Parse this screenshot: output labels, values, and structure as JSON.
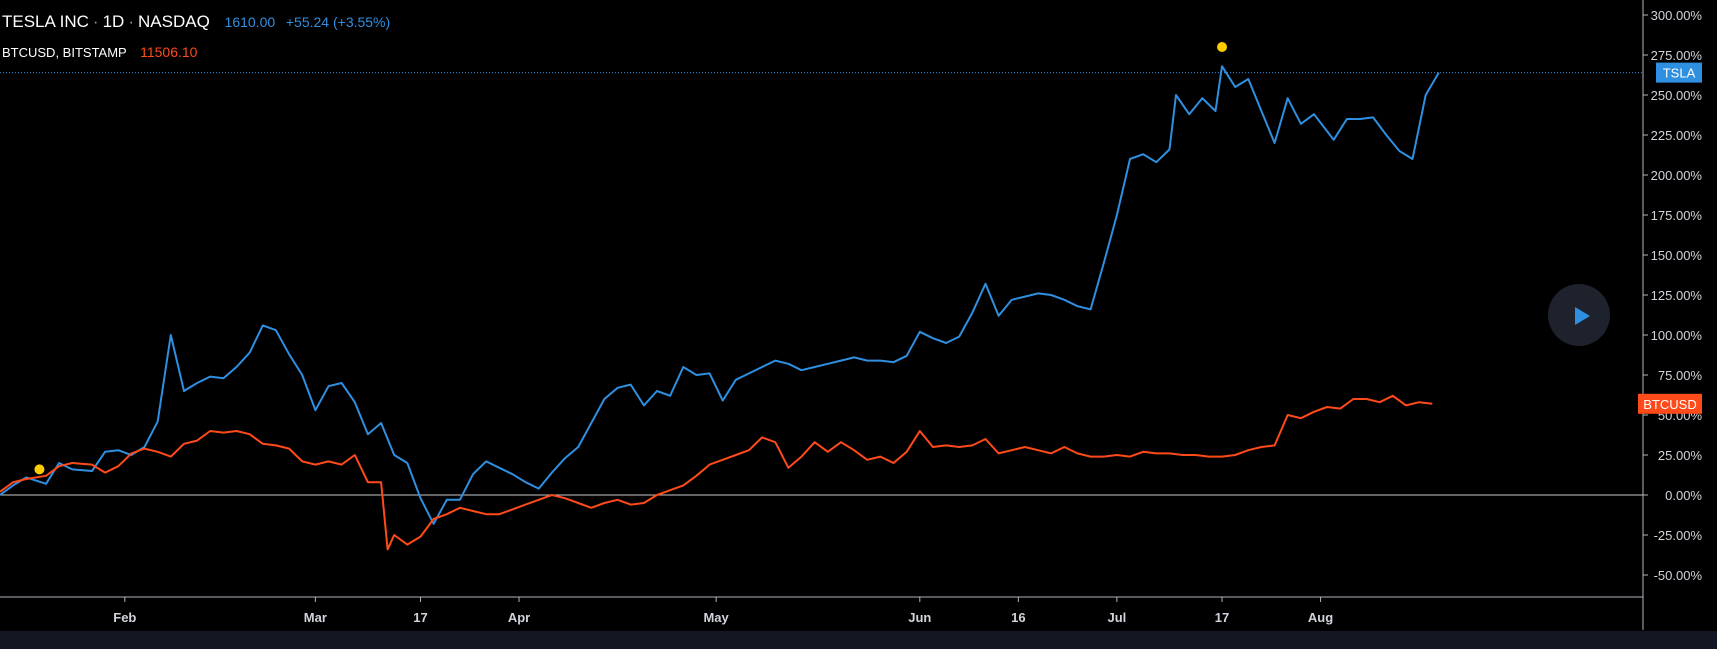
{
  "legend": {
    "main_symbol": "TESLA INC",
    "main_interval": "1D",
    "main_exchange": "NASDAQ",
    "main_price": "1610.00",
    "main_change": "+55.24 (+3.55%)",
    "compare_symbol": "BTCUSD, BITSTAMP",
    "compare_price": "11506.10"
  },
  "colors": {
    "tsla": "#2f8fe0",
    "btc": "#ff4a1a",
    "marker": "#ffcc00",
    "background": "#000000",
    "axis_text": "#d1d4dc"
  },
  "play_button": {
    "icon": "play-icon"
  },
  "chart_data": {
    "type": "line",
    "y_unit": "percent change",
    "ylim": [
      -65,
      305
    ],
    "y_ticks": [
      "300.00%",
      "275.00%",
      "250.00%",
      "225.00%",
      "200.00%",
      "175.00%",
      "150.00%",
      "125.00%",
      "100.00%",
      "75.00%",
      "50.00%",
      "25.00%",
      "0.00%",
      "-25.00%",
      "-50.00%"
    ],
    "y_tick_values": [
      300,
      275,
      250,
      225,
      200,
      175,
      150,
      125,
      100,
      75,
      50,
      25,
      0,
      -25,
      -50
    ],
    "x_start": "2020-01-13",
    "x_end": "2020-08-21",
    "x_ticks": [
      {
        "label": "Feb",
        "date": "2020-02-01"
      },
      {
        "label": "Mar",
        "date": "2020-03-01"
      },
      {
        "label": "17",
        "date": "2020-03-17"
      },
      {
        "label": "Apr",
        "date": "2020-04-01"
      },
      {
        "label": "May",
        "date": "2020-05-01"
      },
      {
        "label": "Jun",
        "date": "2020-06-01"
      },
      {
        "label": "16",
        "date": "2020-06-16"
      },
      {
        "label": "Jul",
        "date": "2020-07-01"
      },
      {
        "label": "17",
        "date": "2020-07-17"
      },
      {
        "label": "Aug",
        "date": "2020-08-01"
      }
    ],
    "series": [
      {
        "name": "TSLA",
        "label": "TSLA",
        "color": "#2f8fe0",
        "points": [
          [
            "2020-01-13",
            0
          ],
          [
            "2020-01-15",
            6
          ],
          [
            "2020-01-17",
            11
          ],
          [
            "2020-01-20",
            7
          ],
          [
            "2020-01-22",
            20
          ],
          [
            "2020-01-24",
            16
          ],
          [
            "2020-01-27",
            15
          ],
          [
            "2020-01-29",
            27
          ],
          [
            "2020-01-31",
            28
          ],
          [
            "2020-02-02",
            25
          ],
          [
            "2020-02-04",
            30
          ],
          [
            "2020-02-06",
            46
          ],
          [
            "2020-02-08",
            100
          ],
          [
            "2020-02-10",
            65
          ],
          [
            "2020-02-12",
            70
          ],
          [
            "2020-02-14",
            74
          ],
          [
            "2020-02-16",
            73
          ],
          [
            "2020-02-18",
            80
          ],
          [
            "2020-02-20",
            89
          ],
          [
            "2020-02-22",
            106
          ],
          [
            "2020-02-24",
            103
          ],
          [
            "2020-02-26",
            88
          ],
          [
            "2020-02-28",
            75
          ],
          [
            "2020-03-01",
            53
          ],
          [
            "2020-03-03",
            68
          ],
          [
            "2020-03-05",
            70
          ],
          [
            "2020-03-07",
            58
          ],
          [
            "2020-03-09",
            38
          ],
          [
            "2020-03-11",
            45
          ],
          [
            "2020-03-13",
            25
          ],
          [
            "2020-03-15",
            20
          ],
          [
            "2020-03-17",
            -2
          ],
          [
            "2020-03-19",
            -18
          ],
          [
            "2020-03-21",
            -3
          ],
          [
            "2020-03-23",
            -3
          ],
          [
            "2020-03-25",
            13
          ],
          [
            "2020-03-27",
            21
          ],
          [
            "2020-03-29",
            17
          ],
          [
            "2020-03-31",
            13
          ],
          [
            "2020-04-02",
            8
          ],
          [
            "2020-04-04",
            4
          ],
          [
            "2020-04-06",
            14
          ],
          [
            "2020-04-08",
            23
          ],
          [
            "2020-04-10",
            30
          ],
          [
            "2020-04-12",
            45
          ],
          [
            "2020-04-14",
            60
          ],
          [
            "2020-04-16",
            67
          ],
          [
            "2020-04-18",
            69
          ],
          [
            "2020-04-20",
            56
          ],
          [
            "2020-04-22",
            65
          ],
          [
            "2020-04-24",
            62
          ],
          [
            "2020-04-26",
            80
          ],
          [
            "2020-04-28",
            75
          ],
          [
            "2020-04-30",
            76
          ],
          [
            "2020-05-02",
            59
          ],
          [
            "2020-05-04",
            72
          ],
          [
            "2020-05-06",
            76
          ],
          [
            "2020-05-08",
            80
          ],
          [
            "2020-05-10",
            84
          ],
          [
            "2020-05-12",
            82
          ],
          [
            "2020-05-14",
            78
          ],
          [
            "2020-05-16",
            80
          ],
          [
            "2020-05-18",
            82
          ],
          [
            "2020-05-20",
            84
          ],
          [
            "2020-05-22",
            86
          ],
          [
            "2020-05-24",
            84
          ],
          [
            "2020-05-26",
            84
          ],
          [
            "2020-05-28",
            83
          ],
          [
            "2020-05-30",
            87
          ],
          [
            "2020-06-01",
            102
          ],
          [
            "2020-06-03",
            98
          ],
          [
            "2020-06-05",
            95
          ],
          [
            "2020-06-07",
            99
          ],
          [
            "2020-06-09",
            114
          ],
          [
            "2020-06-11",
            132
          ],
          [
            "2020-06-13",
            112
          ],
          [
            "2020-06-15",
            122
          ],
          [
            "2020-06-17",
            124
          ],
          [
            "2020-06-19",
            126
          ],
          [
            "2020-06-21",
            125
          ],
          [
            "2020-06-23",
            122
          ],
          [
            "2020-06-25",
            118
          ],
          [
            "2020-06-27",
            116
          ],
          [
            "2020-06-29",
            145
          ],
          [
            "2020-07-01",
            175
          ],
          [
            "2020-07-03",
            210
          ],
          [
            "2020-07-05",
            213
          ],
          [
            "2020-07-07",
            208
          ],
          [
            "2020-07-09",
            216
          ],
          [
            "2020-07-10",
            250
          ],
          [
            "2020-07-12",
            238
          ],
          [
            "2020-07-14",
            248
          ],
          [
            "2020-07-16",
            240
          ],
          [
            "2020-07-17",
            268
          ],
          [
            "2020-07-19",
            255
          ],
          [
            "2020-07-21",
            260
          ],
          [
            "2020-07-23",
            240
          ],
          [
            "2020-07-25",
            220
          ],
          [
            "2020-07-27",
            248
          ],
          [
            "2020-07-29",
            232
          ],
          [
            "2020-07-31",
            238
          ],
          [
            "2020-08-03",
            222
          ],
          [
            "2020-08-05",
            235
          ],
          [
            "2020-08-07",
            235
          ],
          [
            "2020-08-09",
            236
          ],
          [
            "2020-08-11",
            225
          ],
          [
            "2020-08-13",
            215
          ],
          [
            "2020-08-15",
            210
          ],
          [
            "2020-08-17",
            250
          ],
          [
            "2020-08-19",
            264
          ]
        ]
      },
      {
        "name": "BTCUSD",
        "label": "BTCUSD",
        "color": "#ff4a1a",
        "points": [
          [
            "2020-01-13",
            2
          ],
          [
            "2020-01-15",
            8
          ],
          [
            "2020-01-17",
            10
          ],
          [
            "2020-01-20",
            12
          ],
          [
            "2020-01-22",
            18
          ],
          [
            "2020-01-24",
            20
          ],
          [
            "2020-01-27",
            19
          ],
          [
            "2020-01-29",
            14
          ],
          [
            "2020-01-31",
            18
          ],
          [
            "2020-02-02",
            26
          ],
          [
            "2020-02-04",
            29
          ],
          [
            "2020-02-06",
            27
          ],
          [
            "2020-02-08",
            24
          ],
          [
            "2020-02-10",
            32
          ],
          [
            "2020-02-12",
            34
          ],
          [
            "2020-02-14",
            40
          ],
          [
            "2020-02-16",
            39
          ],
          [
            "2020-02-18",
            40
          ],
          [
            "2020-02-20",
            38
          ],
          [
            "2020-02-22",
            32
          ],
          [
            "2020-02-24",
            31
          ],
          [
            "2020-02-26",
            29
          ],
          [
            "2020-02-28",
            21
          ],
          [
            "2020-03-01",
            19
          ],
          [
            "2020-03-03",
            21
          ],
          [
            "2020-03-05",
            19
          ],
          [
            "2020-03-07",
            25
          ],
          [
            "2020-03-09",
            8
          ],
          [
            "2020-03-11",
            8
          ],
          [
            "2020-03-12",
            -34
          ],
          [
            "2020-03-13",
            -25
          ],
          [
            "2020-03-15",
            -31
          ],
          [
            "2020-03-17",
            -26
          ],
          [
            "2020-03-19",
            -15
          ],
          [
            "2020-03-21",
            -12
          ],
          [
            "2020-03-23",
            -8
          ],
          [
            "2020-03-25",
            -10
          ],
          [
            "2020-03-27",
            -12
          ],
          [
            "2020-03-29",
            -12
          ],
          [
            "2020-03-31",
            -9
          ],
          [
            "2020-04-02",
            -6
          ],
          [
            "2020-04-04",
            -3
          ],
          [
            "2020-04-06",
            0
          ],
          [
            "2020-04-08",
            -2
          ],
          [
            "2020-04-10",
            -5
          ],
          [
            "2020-04-12",
            -8
          ],
          [
            "2020-04-14",
            -5
          ],
          [
            "2020-04-16",
            -3
          ],
          [
            "2020-04-18",
            -6
          ],
          [
            "2020-04-20",
            -5
          ],
          [
            "2020-04-22",
            0
          ],
          [
            "2020-04-24",
            3
          ],
          [
            "2020-04-26",
            6
          ],
          [
            "2020-04-28",
            12
          ],
          [
            "2020-04-30",
            19
          ],
          [
            "2020-05-02",
            22
          ],
          [
            "2020-05-04",
            25
          ],
          [
            "2020-05-06",
            28
          ],
          [
            "2020-05-08",
            36
          ],
          [
            "2020-05-10",
            33
          ],
          [
            "2020-05-12",
            17
          ],
          [
            "2020-05-14",
            24
          ],
          [
            "2020-05-16",
            33
          ],
          [
            "2020-05-18",
            27
          ],
          [
            "2020-05-20",
            33
          ],
          [
            "2020-05-22",
            28
          ],
          [
            "2020-05-24",
            22
          ],
          [
            "2020-05-26",
            24
          ],
          [
            "2020-05-28",
            20
          ],
          [
            "2020-05-30",
            27
          ],
          [
            "2020-06-01",
            40
          ],
          [
            "2020-06-03",
            30
          ],
          [
            "2020-06-05",
            31
          ],
          [
            "2020-06-07",
            30
          ],
          [
            "2020-06-09",
            31
          ],
          [
            "2020-06-11",
            35
          ],
          [
            "2020-06-13",
            26
          ],
          [
            "2020-06-15",
            28
          ],
          [
            "2020-06-17",
            30
          ],
          [
            "2020-06-19",
            28
          ],
          [
            "2020-06-21",
            26
          ],
          [
            "2020-06-23",
            30
          ],
          [
            "2020-06-25",
            26
          ],
          [
            "2020-06-27",
            24
          ],
          [
            "2020-06-29",
            24
          ],
          [
            "2020-07-01",
            25
          ],
          [
            "2020-07-03",
            24
          ],
          [
            "2020-07-05",
            27
          ],
          [
            "2020-07-07",
            26
          ],
          [
            "2020-07-09",
            26
          ],
          [
            "2020-07-11",
            25
          ],
          [
            "2020-07-13",
            25
          ],
          [
            "2020-07-15",
            24
          ],
          [
            "2020-07-17",
            24
          ],
          [
            "2020-07-19",
            25
          ],
          [
            "2020-07-21",
            28
          ],
          [
            "2020-07-23",
            30
          ],
          [
            "2020-07-25",
            31
          ],
          [
            "2020-07-27",
            50
          ],
          [
            "2020-07-29",
            48
          ],
          [
            "2020-07-31",
            52
          ],
          [
            "2020-08-02",
            55
          ],
          [
            "2020-08-04",
            54
          ],
          [
            "2020-08-06",
            60
          ],
          [
            "2020-08-08",
            60
          ],
          [
            "2020-08-10",
            58
          ],
          [
            "2020-08-12",
            62
          ],
          [
            "2020-08-14",
            56
          ],
          [
            "2020-08-16",
            58
          ],
          [
            "2020-08-18",
            57
          ]
        ]
      }
    ],
    "markers": [
      {
        "series": "TSLA",
        "date": "2020-01-19",
        "value": 16,
        "color": "#ffcc00"
      },
      {
        "series": "TSLA",
        "date": "2020-07-17",
        "value": 280,
        "color": "#ffcc00"
      }
    ],
    "price_line": {
      "series": "TSLA",
      "value": 264
    }
  }
}
